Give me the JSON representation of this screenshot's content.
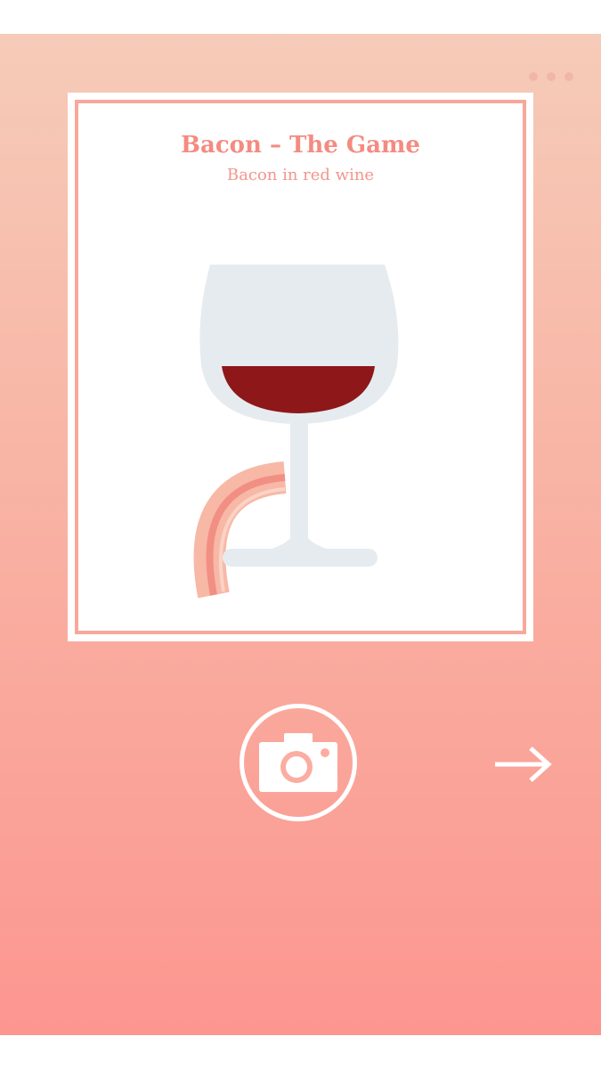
{
  "card": {
    "title": "Bacon – The Game",
    "subtitle": "Bacon in red wine"
  },
  "icons": {
    "menu": "more-dots-icon",
    "camera": "camera-icon",
    "next": "arrow-right-icon"
  },
  "colors": {
    "gradient_top": "#f6cbb8",
    "gradient_bottom": "#fc9690",
    "accent": "#f48b81",
    "wine": "#8e1719",
    "glass": "#e6ebef"
  }
}
